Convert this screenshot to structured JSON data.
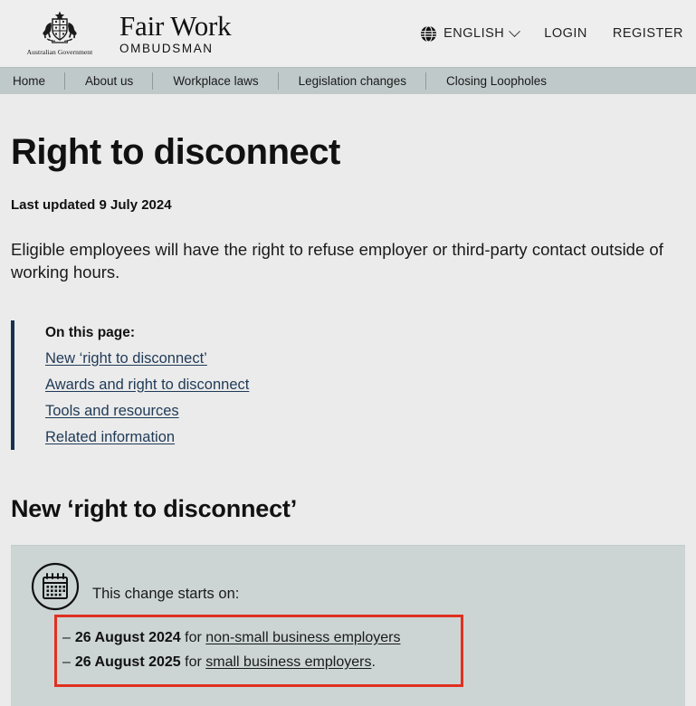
{
  "header": {
    "crest_caption": "Australian Government",
    "crest_icon": "australian-coat-of-arms",
    "brand_line1": "Fair Work",
    "brand_line2": "OMBUDSMAN",
    "globe_icon": "globe-icon",
    "language": "ENGLISH",
    "chevron_icon": "chevron-down-icon",
    "login": "LOGIN",
    "register": "REGISTER"
  },
  "nav": {
    "items": [
      {
        "label": "Home"
      },
      {
        "label": "About us"
      },
      {
        "label": "Workplace laws"
      },
      {
        "label": "Legislation changes"
      },
      {
        "label": "Closing Loopholes"
      }
    ]
  },
  "page": {
    "title": "Right to disconnect",
    "last_updated": "Last updated 9 July 2024",
    "intro": "Eligible employees will have the right to refuse employer or third-party contact outside of working hours."
  },
  "on_this_page": {
    "title": "On this page:",
    "links": [
      {
        "label": "New ‘right to disconnect’"
      },
      {
        "label": "Awards and right to disconnect"
      },
      {
        "label": "Tools and resources"
      },
      {
        "label": "Related information"
      }
    ]
  },
  "section": {
    "heading": "New ‘right to disconnect’"
  },
  "callout": {
    "icon": "calendar-icon",
    "lead": "This change starts on:",
    "dates": [
      {
        "dash": "–",
        "date": "26 August 2024",
        "connector": " for ",
        "link": "non-small business employers",
        "tail": ""
      },
      {
        "dash": "–",
        "date": "26 August 2025",
        "connector": " for ",
        "link": "small business employers",
        "tail": "."
      }
    ]
  },
  "colors": {
    "page_bg": "#ebebeb",
    "header_bg": "#eeeeee",
    "nav_bg": "#bfc9ca",
    "callout_bg": "#ccd5d4",
    "accent_bar": "#17324d",
    "link": "#1f3a57",
    "highlight_box": "#e03020"
  }
}
